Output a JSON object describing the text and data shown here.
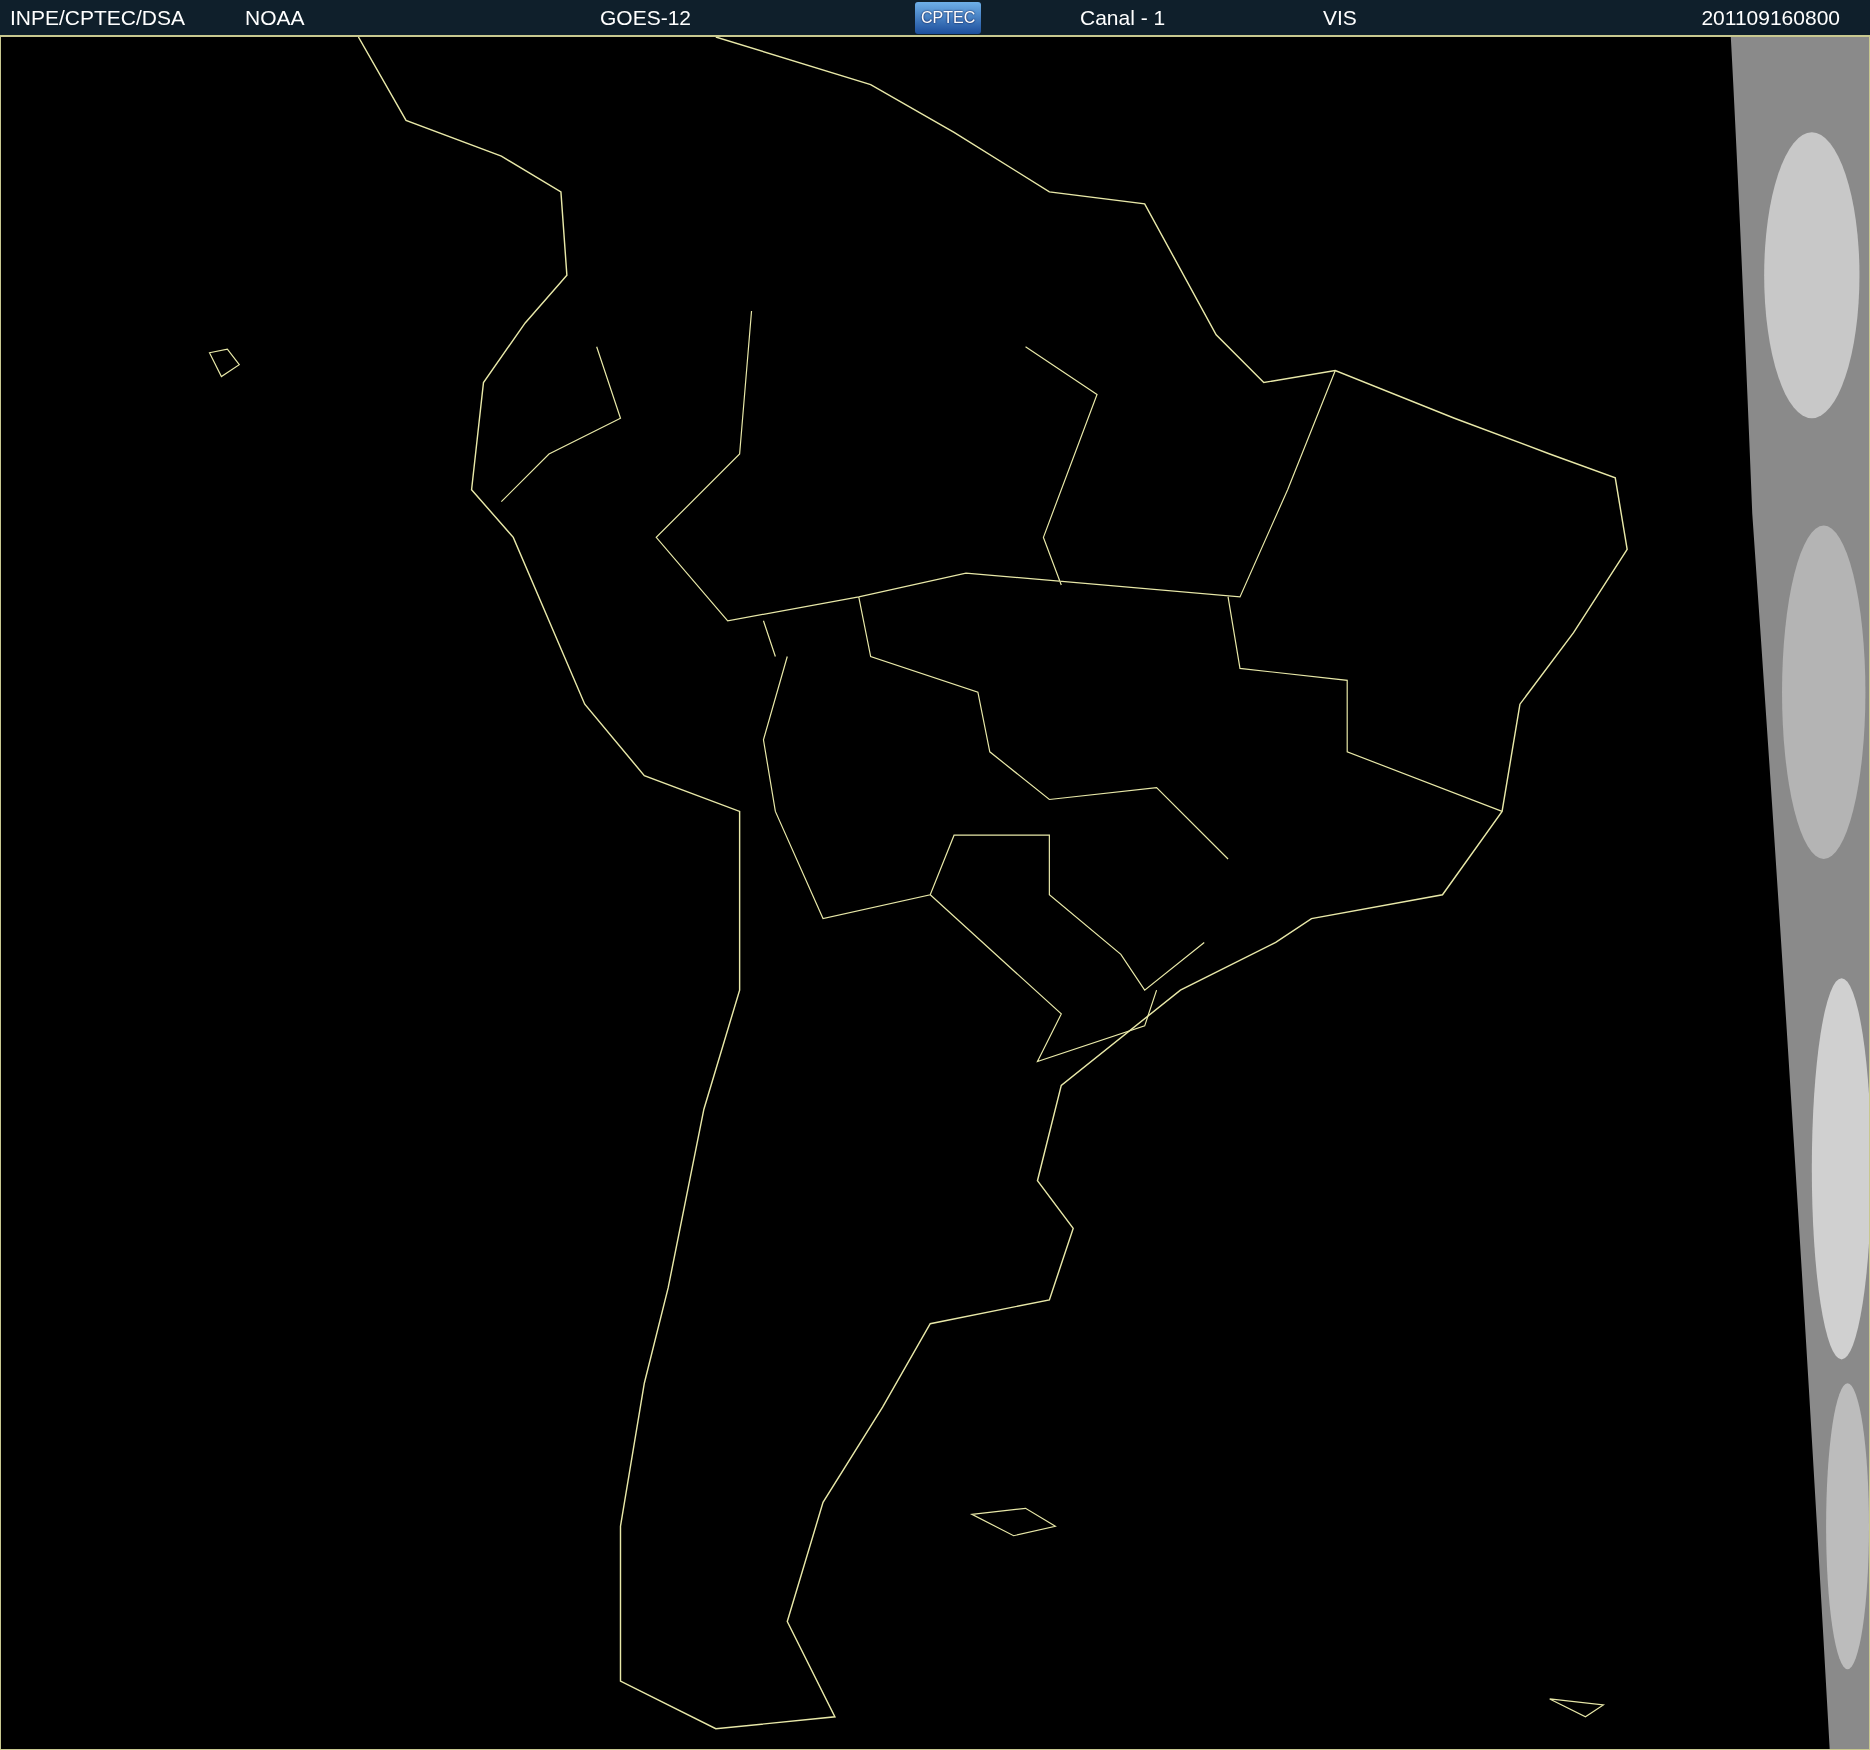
{
  "header": {
    "items": [
      {
        "kind": "text",
        "text": "INPE/CPTEC/DSA"
      },
      {
        "kind": "text",
        "text": "NOAA"
      },
      {
        "kind": "text",
        "text": "GOES-12"
      },
      {
        "kind": "logo",
        "text": "CPTEC"
      },
      {
        "kind": "text",
        "text": "Canal - 1"
      },
      {
        "kind": "text",
        "text": "VIS"
      },
      {
        "kind": "text",
        "text": "201109160800"
      }
    ]
  }
}
